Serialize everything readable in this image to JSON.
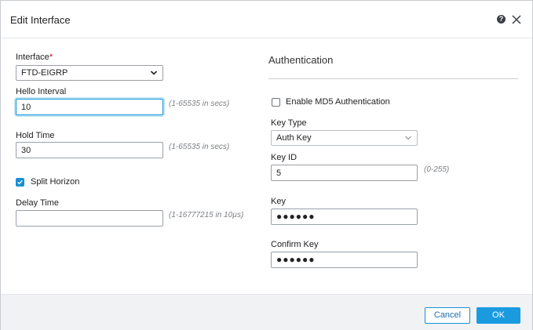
{
  "dialog": {
    "title": "Edit Interface"
  },
  "icons": {
    "help": "help-icon",
    "close": "close-icon",
    "chevron": "chevron-down-icon",
    "check": "check-icon"
  },
  "left": {
    "interface": {
      "label": "Interface",
      "required_mark": "*",
      "value": "FTD-EIGRP"
    },
    "hello_interval": {
      "label": "Hello Interval",
      "value": "10",
      "hint": "(1-65535 in secs)"
    },
    "hold_time": {
      "label": "Hold Time",
      "value": "30",
      "hint": "(1-65535 in secs)"
    },
    "split_horizon": {
      "label": "Split Horizon",
      "checked": true
    },
    "delay_time": {
      "label": "Delay Time",
      "value": "",
      "hint": "(1-16777215 in 10µs)"
    }
  },
  "right": {
    "section_title": "Authentication",
    "enable_md5": {
      "label": "Enable MD5 Authentication",
      "checked": false
    },
    "key_type": {
      "label": "Key Type",
      "value": "Auth Key"
    },
    "key_id": {
      "label": "Key ID",
      "value": "5",
      "hint": "(0-255)"
    },
    "key": {
      "label": "Key",
      "value": "●●●●●●"
    },
    "confirm_key": {
      "label": "Confirm Key",
      "value": "●●●●●●"
    }
  },
  "footer": {
    "cancel_label": "Cancel",
    "ok_label": "OK"
  },
  "colors": {
    "accent": "#1a9be0",
    "required": "#d0021b",
    "focus": "#1a94d8"
  }
}
